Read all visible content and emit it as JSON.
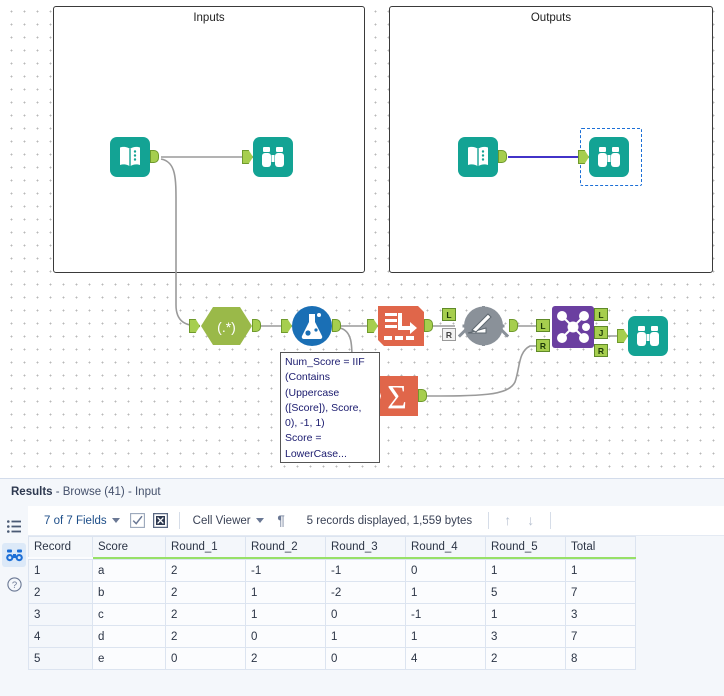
{
  "canvas": {
    "containers": [
      {
        "title": "Inputs"
      },
      {
        "title": "Outputs"
      }
    ],
    "tools": [
      {
        "name": "input-data-1",
        "label": "Input Data"
      },
      {
        "name": "browse-1",
        "label": "Browse"
      },
      {
        "name": "input-data-2",
        "label": "Input Data"
      },
      {
        "name": "browse-2",
        "label": "Browse"
      },
      {
        "name": "regex",
        "label": "RegEx",
        "glyph": "(.*)"
      },
      {
        "name": "formula",
        "label": "Formula"
      },
      {
        "name": "transpose",
        "label": "Transpose"
      },
      {
        "name": "summarize",
        "label": "Summarize",
        "glyph": "Σ"
      },
      {
        "name": "append-fields",
        "label": "Append Fields"
      },
      {
        "name": "join",
        "label": "Join"
      },
      {
        "name": "browse-3",
        "label": "Browse"
      }
    ],
    "anchors": {
      "left": "L",
      "right": "R",
      "join": "J"
    },
    "annotation": "Num_Score = IIF\n(Contains\n(Uppercase\n([Score]), Score,\n0), -1, 1)\nScore =\nLowerCase..."
  },
  "results": {
    "header_bold": "Results",
    "header_rest": " - Browse (41) - Input",
    "toolbar": {
      "fields": "7 of 7 Fields",
      "cell_viewer": "Cell Viewer",
      "records": "5 records displayed, 1,559 bytes",
      "icons": {
        "check": "checkbox-checked-icon",
        "uncheck": "checkbox-cross-icon",
        "pilcrow": "¶",
        "up": "↑",
        "down": "↓"
      }
    },
    "sidebar": [
      {
        "name": "list-icon"
      },
      {
        "name": "binoculars-icon"
      },
      {
        "name": "help-icon"
      }
    ],
    "table": {
      "columns": [
        "Record",
        "Score",
        "Round_1",
        "Round_2",
        "Round_3",
        "Round_4",
        "Round_5",
        "Total"
      ],
      "rows": [
        [
          "1",
          "a",
          "2",
          "-1",
          "-1",
          "0",
          "1",
          "1"
        ],
        [
          "2",
          "b",
          "2",
          "1",
          "-2",
          "1",
          "5",
          "7"
        ],
        [
          "3",
          "c",
          "2",
          "1",
          "0",
          "-1",
          "1",
          "3"
        ],
        [
          "4",
          "d",
          "2",
          "0",
          "1",
          "1",
          "3",
          "7"
        ],
        [
          "5",
          "e",
          "0",
          "2",
          "0",
          "4",
          "2",
          "8"
        ]
      ]
    }
  },
  "colors": {
    "teal": "#13a394",
    "green_anchor": "#a6ce4e",
    "orange": "#e0664a",
    "purple": "#6b3fa0",
    "blue_flask": "#1a6fb5",
    "regex_green": "#9ab949",
    "gray_tool": "#8a9199",
    "selection": "#1b6fd6",
    "header_underline": "#97e067"
  }
}
